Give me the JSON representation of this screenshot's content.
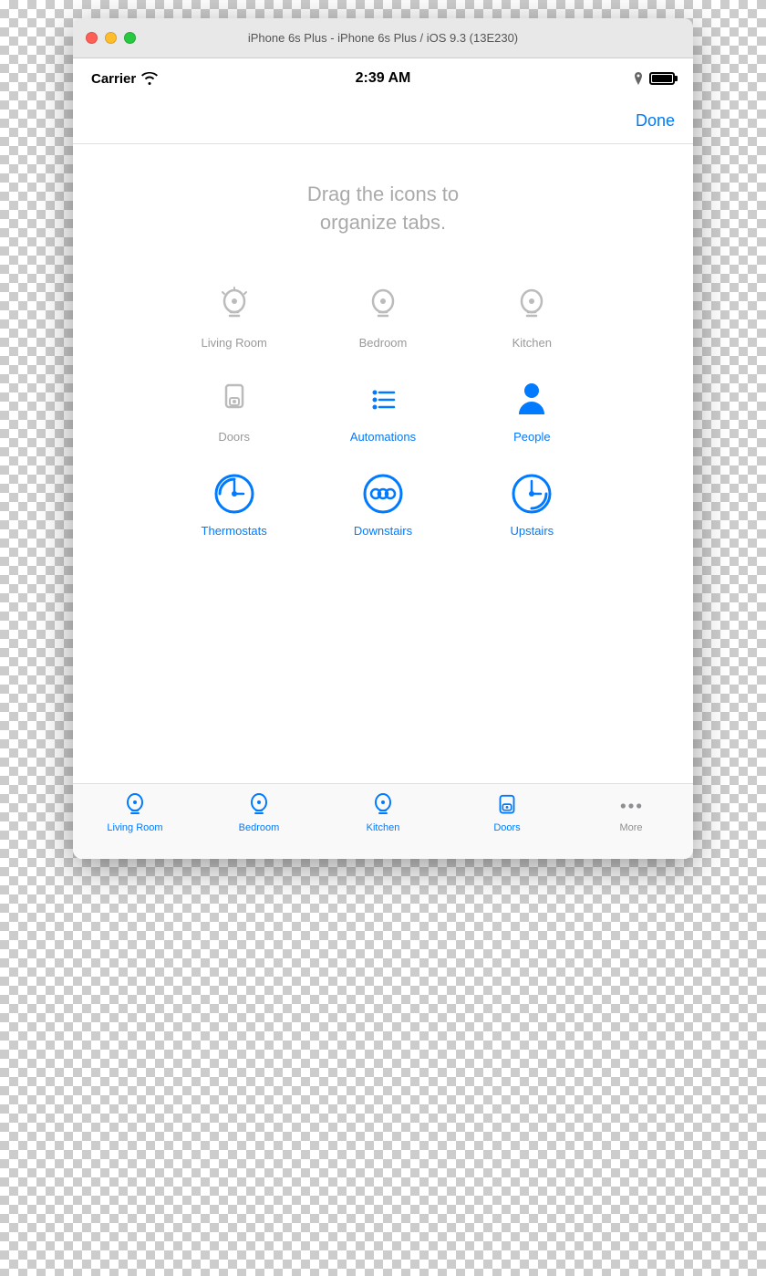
{
  "window": {
    "title": "iPhone 6s Plus - iPhone 6s Plus / iOS 9.3 (13E230)"
  },
  "statusBar": {
    "carrier": "Carrier",
    "time": "2:39 AM"
  },
  "navBar": {
    "doneLabel": "Done"
  },
  "main": {
    "instruction": "Drag the icons to\norganize tabs."
  },
  "inactiveIcons": [
    {
      "id": "living-room",
      "label": "Living Room",
      "type": "bulb",
      "active": false
    },
    {
      "id": "bedroom",
      "label": "Bedroom",
      "type": "bulb",
      "active": false
    },
    {
      "id": "kitchen",
      "label": "Kitchen",
      "type": "bulb",
      "active": false
    },
    {
      "id": "doors",
      "label": "Doors",
      "type": "lock",
      "active": false
    },
    {
      "id": "automations",
      "label": "Automations",
      "type": "list",
      "active": true
    },
    {
      "id": "people",
      "label": "People",
      "type": "person",
      "active": true
    },
    {
      "id": "thermostats",
      "label": "Thermostats",
      "type": "gauge",
      "active": true
    },
    {
      "id": "downstairs",
      "label": "Downstairs",
      "type": "circles",
      "active": true
    },
    {
      "id": "upstairs",
      "label": "Upstairs",
      "type": "gauge",
      "active": true
    }
  ],
  "tabBar": {
    "items": [
      {
        "id": "living-room",
        "label": "Living Room",
        "type": "bulb",
        "active": true
      },
      {
        "id": "bedroom",
        "label": "Bedroom",
        "type": "bulb",
        "active": true
      },
      {
        "id": "kitchen",
        "label": "Kitchen",
        "type": "bulb",
        "active": true
      },
      {
        "id": "doors",
        "label": "Doors",
        "type": "lock",
        "active": true
      },
      {
        "id": "more",
        "label": "More",
        "type": "dots",
        "active": false
      }
    ]
  },
  "colors": {
    "blue": "#007AFF",
    "gray": "#999",
    "darkGray": "#555"
  }
}
